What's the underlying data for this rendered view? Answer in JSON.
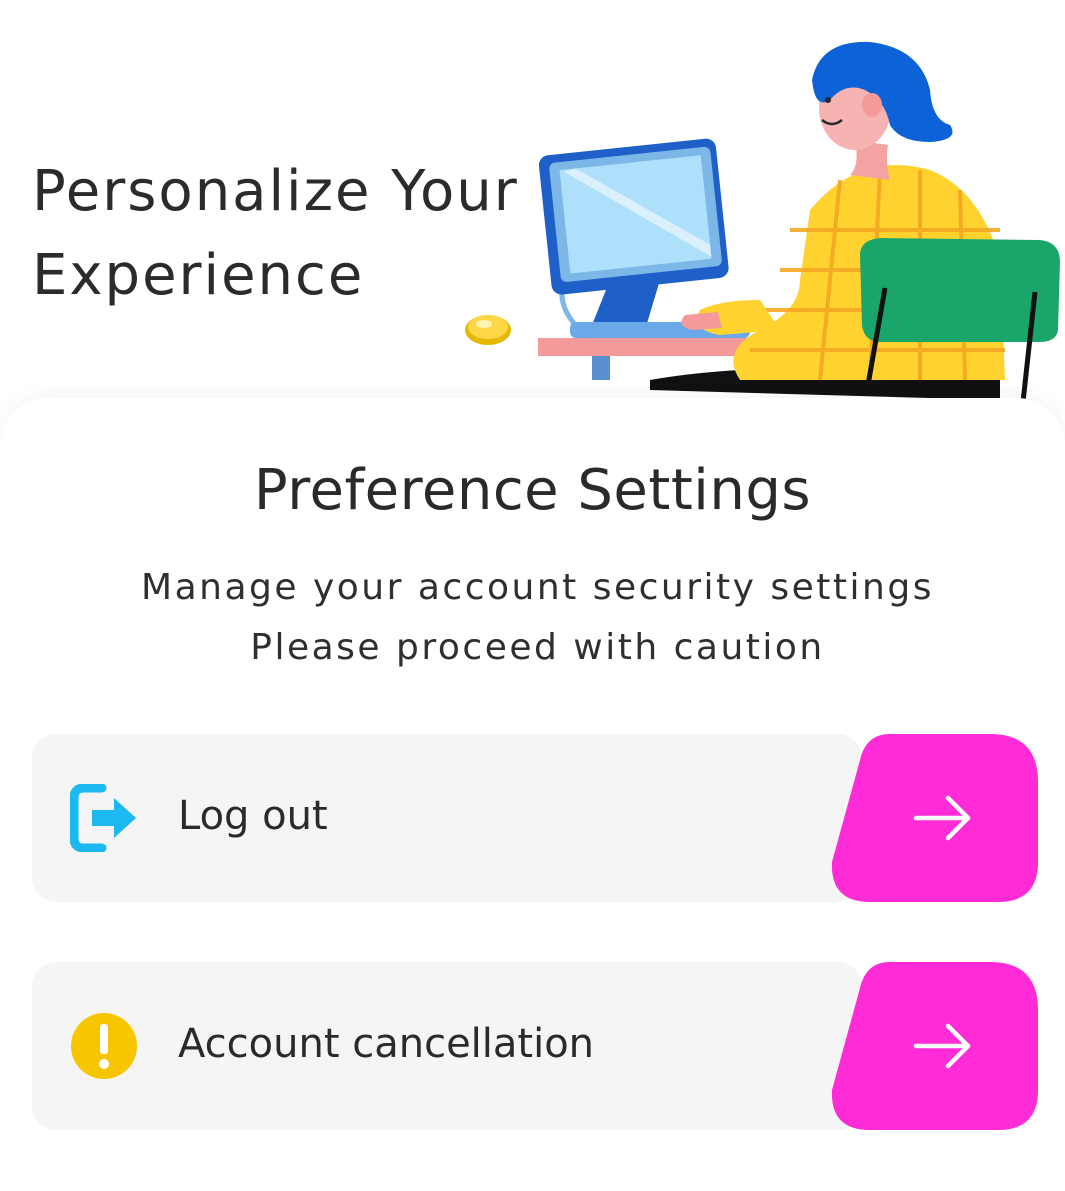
{
  "hero": {
    "title_line1": "Personalize Your",
    "title_line2": "Experience"
  },
  "settings": {
    "title": "Preference Settings",
    "description_line1": "Manage your account security settings",
    "description_line2": "Please proceed with caution"
  },
  "actions": [
    {
      "label": "Log out",
      "icon": "logout-icon"
    },
    {
      "label": "Account cancellation",
      "icon": "warning-icon"
    }
  ],
  "colors": {
    "accent": "#ff2bd6",
    "logout_icon": "#1cb8f0",
    "warning_icon": "#f7c600",
    "row_background": "#f5f5f6"
  }
}
